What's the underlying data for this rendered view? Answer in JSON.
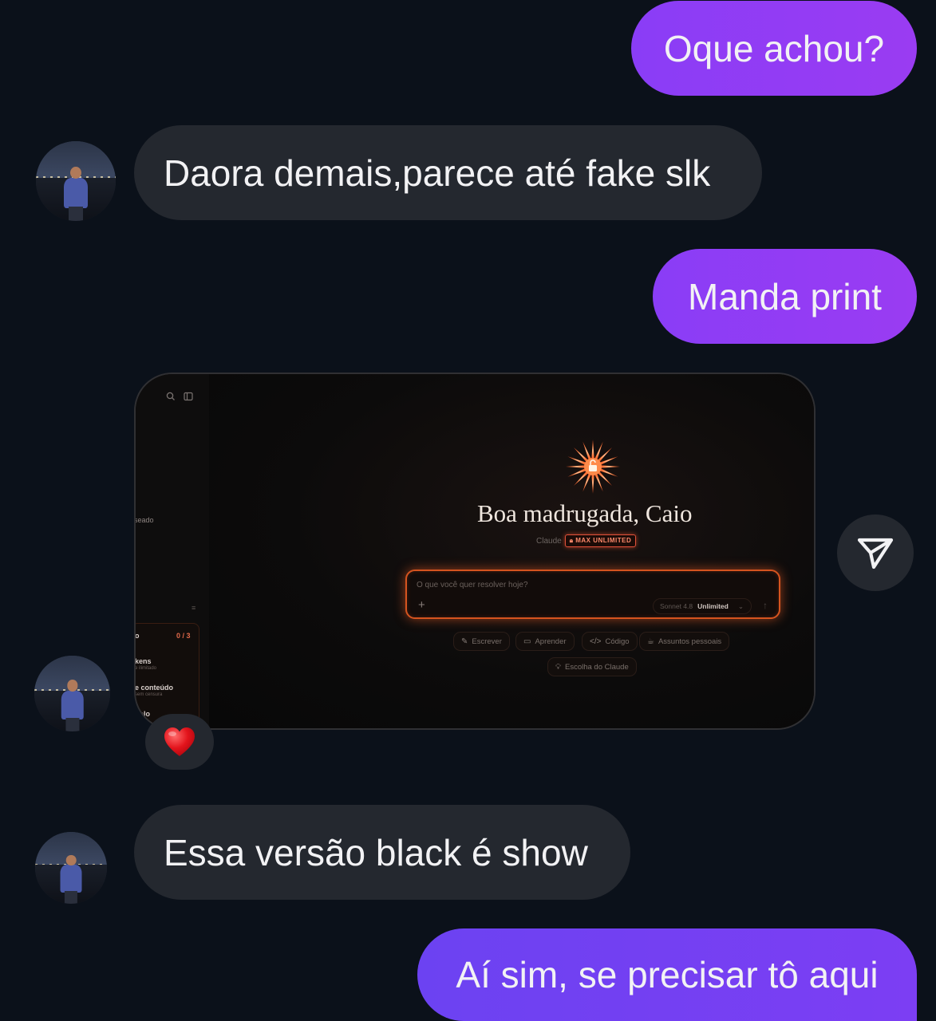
{
  "messages": {
    "m1": "Oque achou?",
    "m2": "Daora demais,parece até fake slk",
    "m3": "Manda print",
    "m5": "Essa versão black é show",
    "m6": "Aí sim, se precisar tô aqui"
  },
  "reaction": {
    "emoji": "❤️"
  },
  "icons": {
    "share": "send-icon",
    "heart": "heart-icon",
    "avatar": "profile-photo"
  },
  "colors": {
    "background": "#0b111a",
    "outgoing_bubble": "#9a3cf2",
    "incoming_bubble": "#24282f",
    "accent_glow": "#d5541f"
  },
  "screenshot": {
    "sidebar": {
      "frag_1": "seado",
      "frag_counter_label": "o",
      "frag_counter": "0 / 3",
      "frag_tokens": "kens",
      "frag_tokens_sub": "e ilimitado",
      "frag_content": "e conteúdo",
      "frag_content_sub": "sem censura",
      "frag_model": "elo"
    },
    "greeting": "Boa madrugada, Caio",
    "model_name": "Claude",
    "plan_badge": "MAX UNLIMITED",
    "prompt_placeholder": "O que você quer resolver hoje?",
    "plus": "+",
    "model_select": "Sonnet 4.8",
    "model_select_limit": "Unlimited",
    "chips": {
      "write": "Escrever",
      "learn": "Aprender",
      "code": "Código",
      "personal": "Assuntos pessoais",
      "choice": "Escolha do Claude"
    }
  }
}
